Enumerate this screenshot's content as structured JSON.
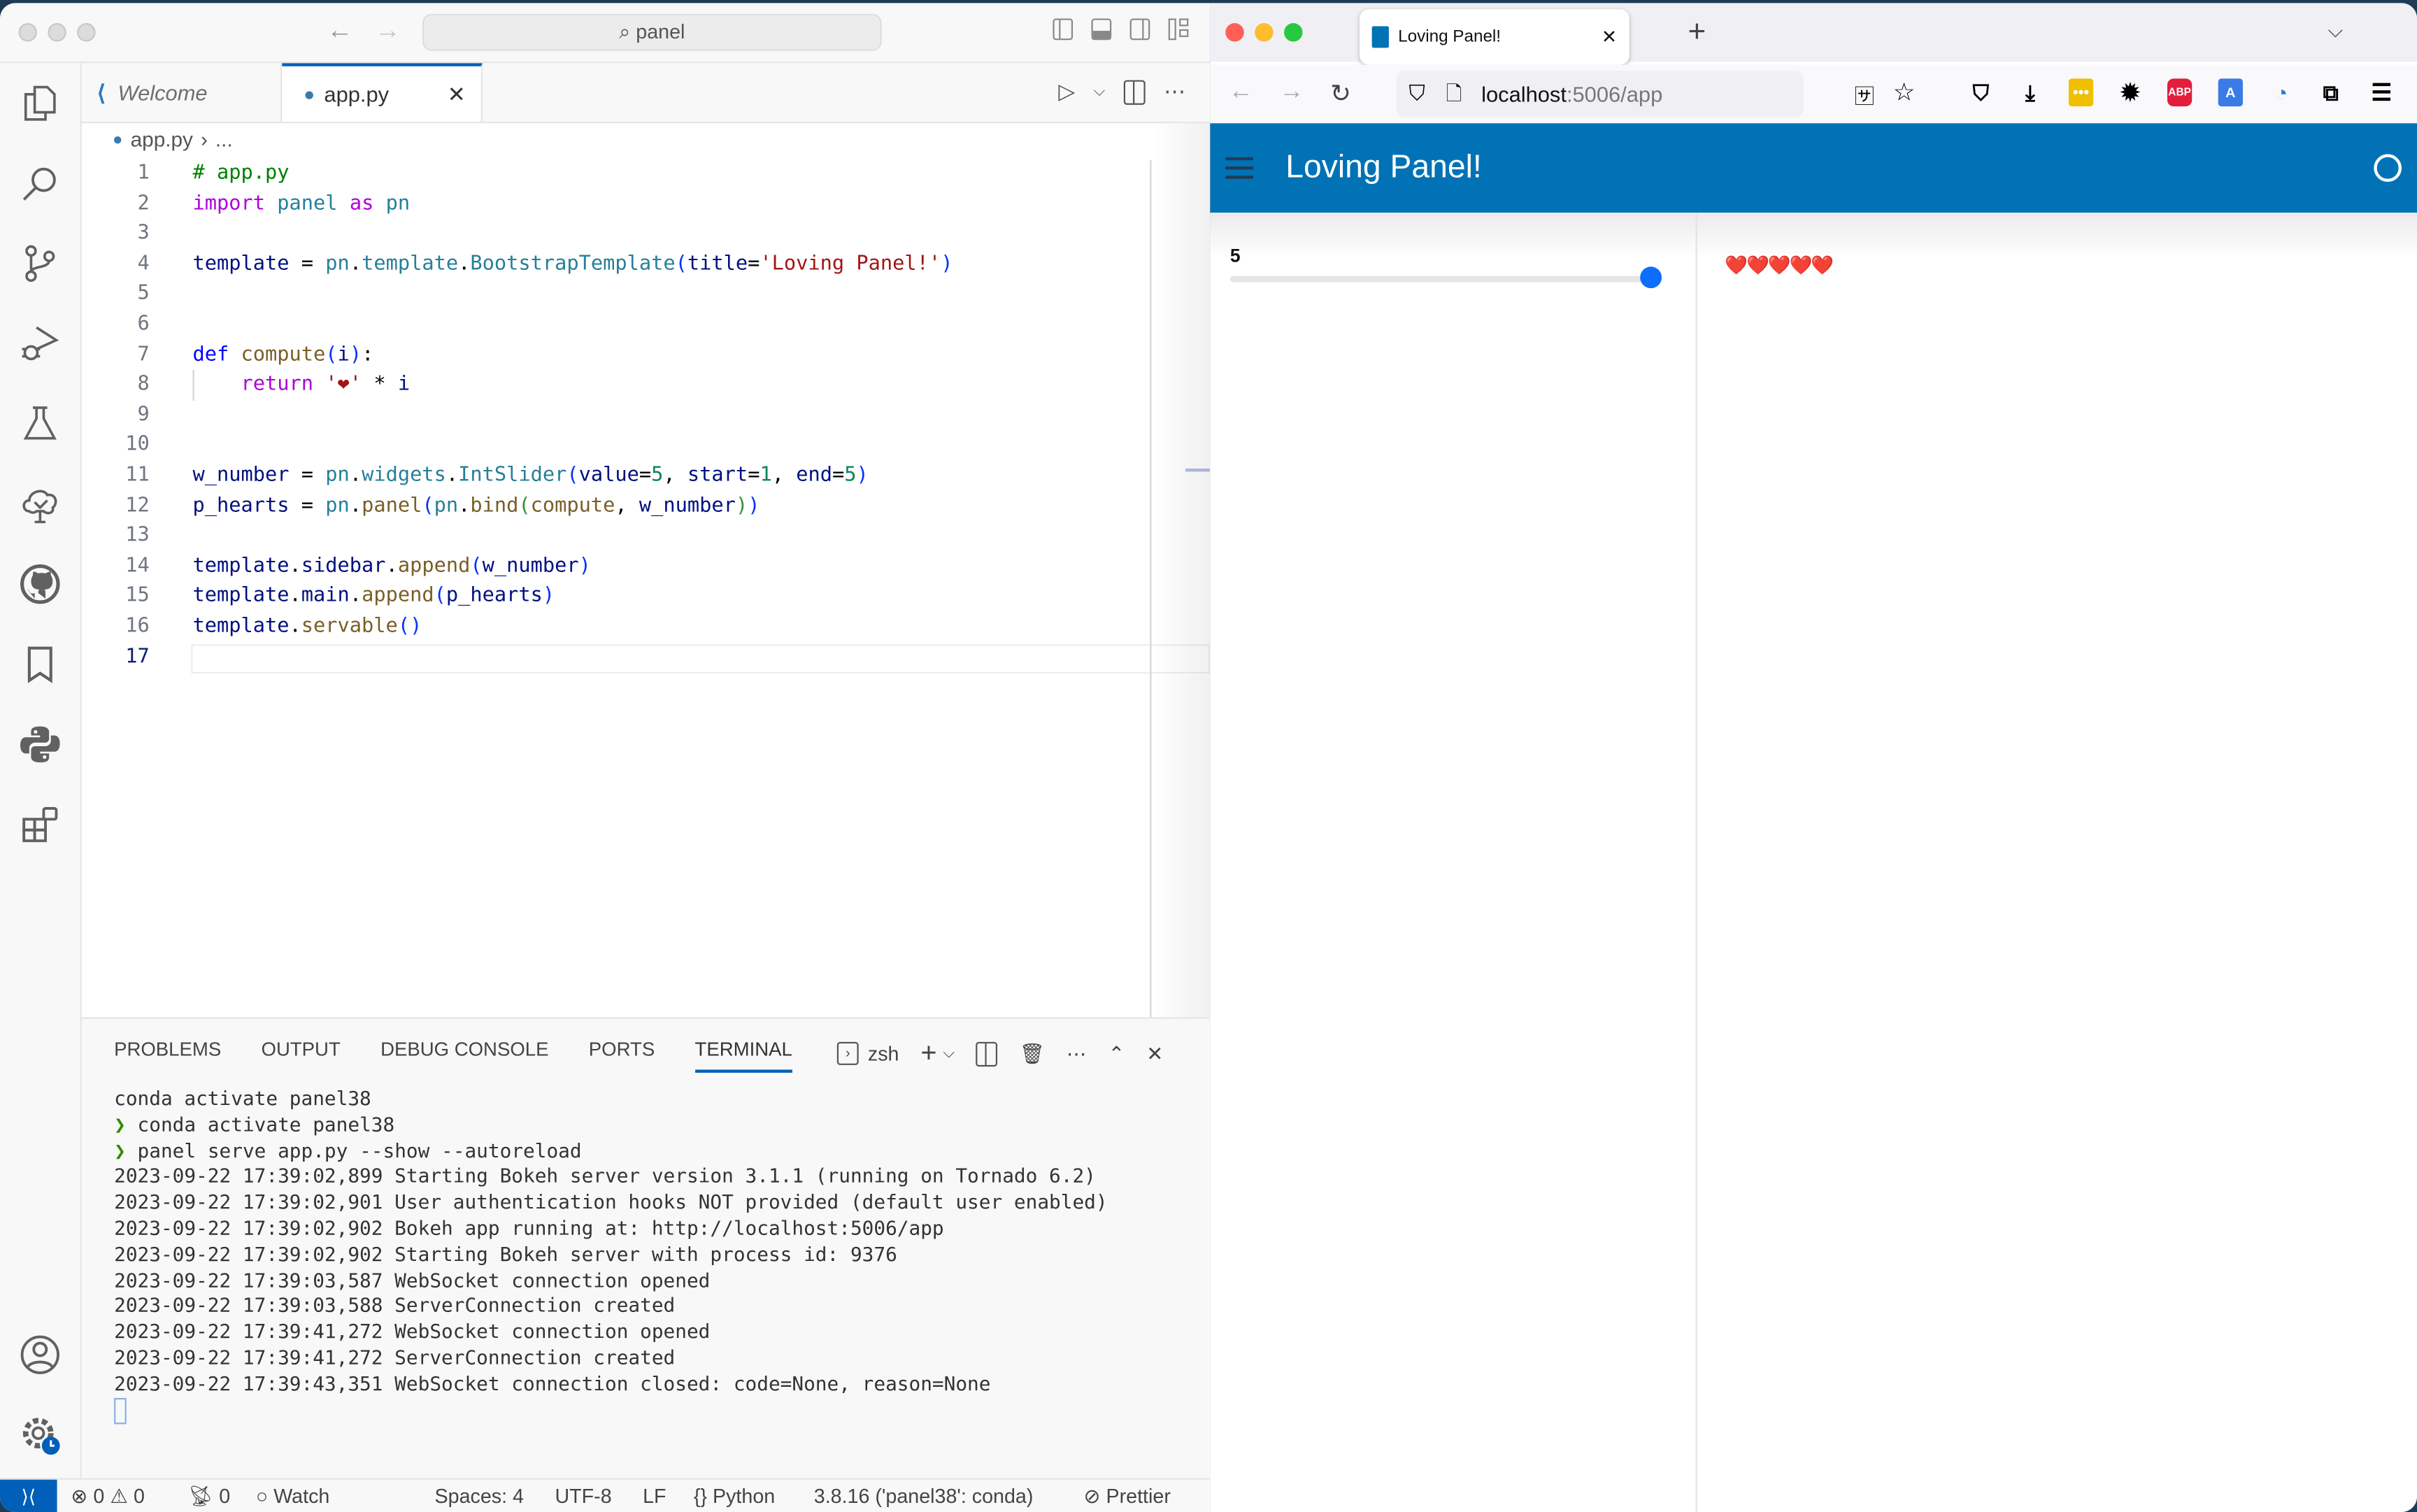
{
  "vscode": {
    "command_center": "panel",
    "tabs": [
      {
        "label": "Welcome",
        "icon": "vscode-logo-icon",
        "active": false
      },
      {
        "label": "app.py",
        "icon": "python-file-icon",
        "active": true
      }
    ],
    "breadcrumb": {
      "file": "app.py",
      "rest": "..."
    },
    "activity_bar": [
      "explorer-icon",
      "search-icon",
      "source-control-icon",
      "run-debug-icon",
      "testing-icon",
      "tree-check-icon",
      "github-icon",
      "bookmark-icon",
      "python-icon",
      "extensions-icon",
      "account-icon",
      "manage-gear-icon"
    ],
    "code_lines": [
      {
        "n": "1",
        "tokens": [
          [
            "c-com",
            "# app.py"
          ]
        ]
      },
      {
        "n": "2",
        "tokens": [
          [
            "c-kw",
            "import"
          ],
          [
            "c-op",
            " "
          ],
          [
            "c-mod",
            "panel"
          ],
          [
            "c-op",
            " "
          ],
          [
            "c-kw",
            "as"
          ],
          [
            "c-op",
            " "
          ],
          [
            "c-mod",
            "pn"
          ]
        ]
      },
      {
        "n": "3",
        "tokens": []
      },
      {
        "n": "4",
        "tokens": [
          [
            "c-var",
            "template"
          ],
          [
            "c-op",
            " = "
          ],
          [
            "c-mod",
            "pn"
          ],
          [
            "c-op",
            "."
          ],
          [
            "c-mod",
            "template"
          ],
          [
            "c-op",
            "."
          ],
          [
            "c-mod",
            "BootstrapTemplate"
          ],
          [
            "c-p1",
            "("
          ],
          [
            "c-var",
            "title"
          ],
          [
            "c-op",
            "="
          ],
          [
            "c-str",
            "'Loving Panel!'"
          ],
          [
            "c-p1",
            ")"
          ]
        ]
      },
      {
        "n": "5",
        "tokens": []
      },
      {
        "n": "6",
        "tokens": []
      },
      {
        "n": "7",
        "tokens": [
          [
            "c-kw2",
            "def"
          ],
          [
            "c-op",
            " "
          ],
          [
            "c-fn",
            "compute"
          ],
          [
            "c-p1",
            "("
          ],
          [
            "c-var",
            "i"
          ],
          [
            "c-p1",
            ")"
          ],
          [
            "c-op",
            ":"
          ]
        ]
      },
      {
        "n": "8",
        "indent": true,
        "tokens": [
          [
            "c-op",
            "    "
          ],
          [
            "c-kw",
            "return"
          ],
          [
            "c-op",
            " "
          ],
          [
            "c-str",
            "'❤'"
          ],
          [
            "c-op",
            " * "
          ],
          [
            "c-var",
            "i"
          ]
        ]
      },
      {
        "n": "9",
        "tokens": []
      },
      {
        "n": "10",
        "tokens": []
      },
      {
        "n": "11",
        "tokens": [
          [
            "c-var",
            "w_number"
          ],
          [
            "c-op",
            " = "
          ],
          [
            "c-mod",
            "pn"
          ],
          [
            "c-op",
            "."
          ],
          [
            "c-mod",
            "widgets"
          ],
          [
            "c-op",
            "."
          ],
          [
            "c-mod",
            "IntSlider"
          ],
          [
            "c-p1",
            "("
          ],
          [
            "c-var",
            "value"
          ],
          [
            "c-op",
            "="
          ],
          [
            "c-num",
            "5"
          ],
          [
            "c-op",
            ", "
          ],
          [
            "c-var",
            "start"
          ],
          [
            "c-op",
            "="
          ],
          [
            "c-num",
            "1"
          ],
          [
            "c-op",
            ", "
          ],
          [
            "c-var",
            "end"
          ],
          [
            "c-op",
            "="
          ],
          [
            "c-num",
            "5"
          ],
          [
            "c-p1",
            ")"
          ]
        ]
      },
      {
        "n": "12",
        "tokens": [
          [
            "c-var",
            "p_hearts"
          ],
          [
            "c-op",
            " = "
          ],
          [
            "c-mod",
            "pn"
          ],
          [
            "c-op",
            "."
          ],
          [
            "c-fn",
            "panel"
          ],
          [
            "c-p1",
            "("
          ],
          [
            "c-mod",
            "pn"
          ],
          [
            "c-op",
            "."
          ],
          [
            "c-fn",
            "bind"
          ],
          [
            "c-p2",
            "("
          ],
          [
            "c-fn",
            "compute"
          ],
          [
            "c-op",
            ", "
          ],
          [
            "c-var",
            "w_number"
          ],
          [
            "c-p2",
            ")"
          ],
          [
            "c-p1",
            ")"
          ]
        ]
      },
      {
        "n": "13",
        "tokens": []
      },
      {
        "n": "14",
        "tokens": [
          [
            "c-var",
            "template"
          ],
          [
            "c-op",
            "."
          ],
          [
            "c-var",
            "sidebar"
          ],
          [
            "c-op",
            "."
          ],
          [
            "c-fn",
            "append"
          ],
          [
            "c-p1",
            "("
          ],
          [
            "c-var",
            "w_number"
          ],
          [
            "c-p1",
            ")"
          ]
        ]
      },
      {
        "n": "15",
        "tokens": [
          [
            "c-var",
            "template"
          ],
          [
            "c-op",
            "."
          ],
          [
            "c-var",
            "main"
          ],
          [
            "c-op",
            "."
          ],
          [
            "c-fn",
            "append"
          ],
          [
            "c-p1",
            "("
          ],
          [
            "c-var",
            "p_hearts"
          ],
          [
            "c-p1",
            ")"
          ]
        ]
      },
      {
        "n": "16",
        "tokens": [
          [
            "c-var",
            "template"
          ],
          [
            "c-op",
            "."
          ],
          [
            "c-fn",
            "servable"
          ],
          [
            "c-p1",
            "()"
          ]
        ]
      },
      {
        "n": "17",
        "current": true,
        "tokens": []
      }
    ],
    "panel": {
      "tabs": [
        "PROBLEMS",
        "OUTPUT",
        "DEBUG CONSOLE",
        "PORTS",
        "TERMINAL"
      ],
      "active_tab": "TERMINAL",
      "shell": "zsh",
      "terminal_lines": [
        {
          "prompt": false,
          "text": "conda activate panel38"
        },
        {
          "prompt": true,
          "text": "conda activate panel38"
        },
        {
          "prompt": true,
          "text": "panel serve app.py --show --autoreload"
        },
        {
          "prompt": false,
          "text": "2023-09-22 17:39:02,899 Starting Bokeh server version 3.1.1 (running on Tornado 6.2)"
        },
        {
          "prompt": false,
          "text": "2023-09-22 17:39:02,901 User authentication hooks NOT provided (default user enabled)"
        },
        {
          "prompt": false,
          "text": "2023-09-22 17:39:02,902 Bokeh app running at: http://localhost:5006/app"
        },
        {
          "prompt": false,
          "text": "2023-09-22 17:39:02,902 Starting Bokeh server with process id: 9376"
        },
        {
          "prompt": false,
          "text": "2023-09-22 17:39:03,587 WebSocket connection opened"
        },
        {
          "prompt": false,
          "text": "2023-09-22 17:39:03,588 ServerConnection created"
        },
        {
          "prompt": false,
          "text": "2023-09-22 17:39:41,272 WebSocket connection opened"
        },
        {
          "prompt": false,
          "text": "2023-09-22 17:39:41,272 ServerConnection created"
        },
        {
          "prompt": false,
          "text": "2023-09-22 17:39:43,351 WebSocket connection closed: code=None, reason=None"
        }
      ]
    },
    "statusbar": {
      "errors": "0",
      "warnings": "0",
      "ports": "0",
      "watch": "Watch",
      "spaces": "Spaces: 4",
      "encoding": "UTF-8",
      "eol": "LF",
      "language": "Python",
      "interpreter": "3.8.16 ('panel38': conda)",
      "formatter": "Prettier"
    }
  },
  "firefox": {
    "tab_title": "Loving Panel!",
    "url_host": "localhost",
    "url_rest": ":5006/app",
    "extensions": [
      "pocket-icon",
      "download-icon",
      "dots-extension-icon",
      "sun-extension-icon",
      "adblock-plus-icon",
      "translate-extension-icon",
      "lock-extension-icon",
      "extensions-puzzle-icon",
      "menu-icon"
    ]
  },
  "app": {
    "title": "Loving Panel!",
    "header_color": "#0072b5",
    "slider": {
      "label": "5",
      "value": 5,
      "start": 1,
      "end": 5
    },
    "hearts": "❤️❤️❤️❤️❤️"
  }
}
